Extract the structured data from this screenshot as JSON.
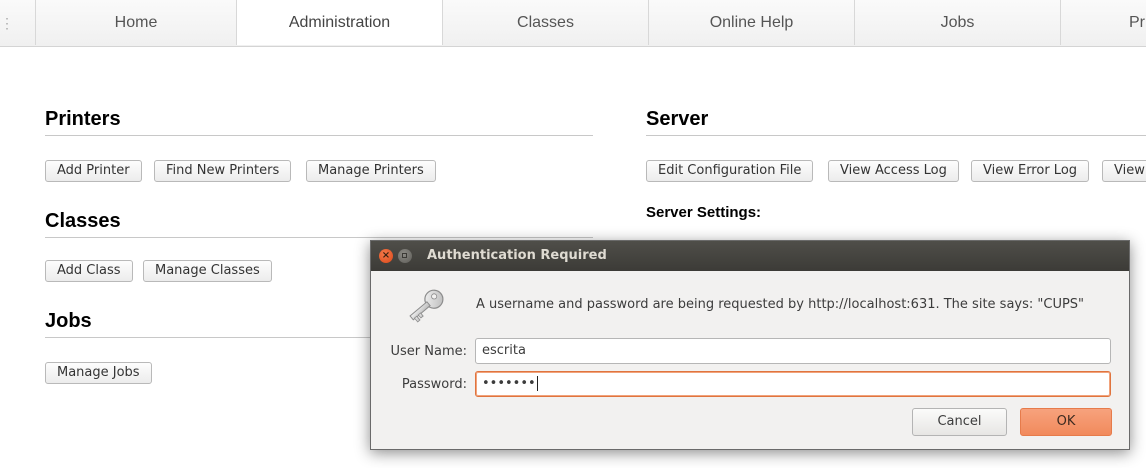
{
  "nav": {
    "tabs": [
      {
        "label": "Home"
      },
      {
        "label": "Administration"
      },
      {
        "label": "Classes"
      },
      {
        "label": "Online Help"
      },
      {
        "label": "Jobs"
      },
      {
        "label": "Pr"
      }
    ],
    "active_tab": "Administration"
  },
  "printers": {
    "heading": "Printers",
    "buttons": [
      "Add Printer",
      "Find New Printers",
      "Manage Printers"
    ]
  },
  "classes": {
    "heading": "Classes",
    "buttons": [
      "Add Class",
      "Manage Classes"
    ]
  },
  "jobs": {
    "heading": "Jobs",
    "buttons": [
      "Manage Jobs"
    ]
  },
  "server": {
    "heading": "Server",
    "buttons": [
      "Edit Configuration File",
      "View Access Log",
      "View Error Log",
      "View"
    ],
    "settings_label": "Server Settings:"
  },
  "dialog": {
    "title": "Authentication Required",
    "message": "A username and password are being requested by http://localhost:631. The site says: \"CUPS\"",
    "username_label": "User Name:",
    "username_value": "escrita",
    "password_label": "Password:",
    "password_value": "•••••••",
    "cancel_label": "Cancel",
    "ok_label": "OK",
    "icon": "key-icon",
    "accent_color": "#f18a5c"
  }
}
